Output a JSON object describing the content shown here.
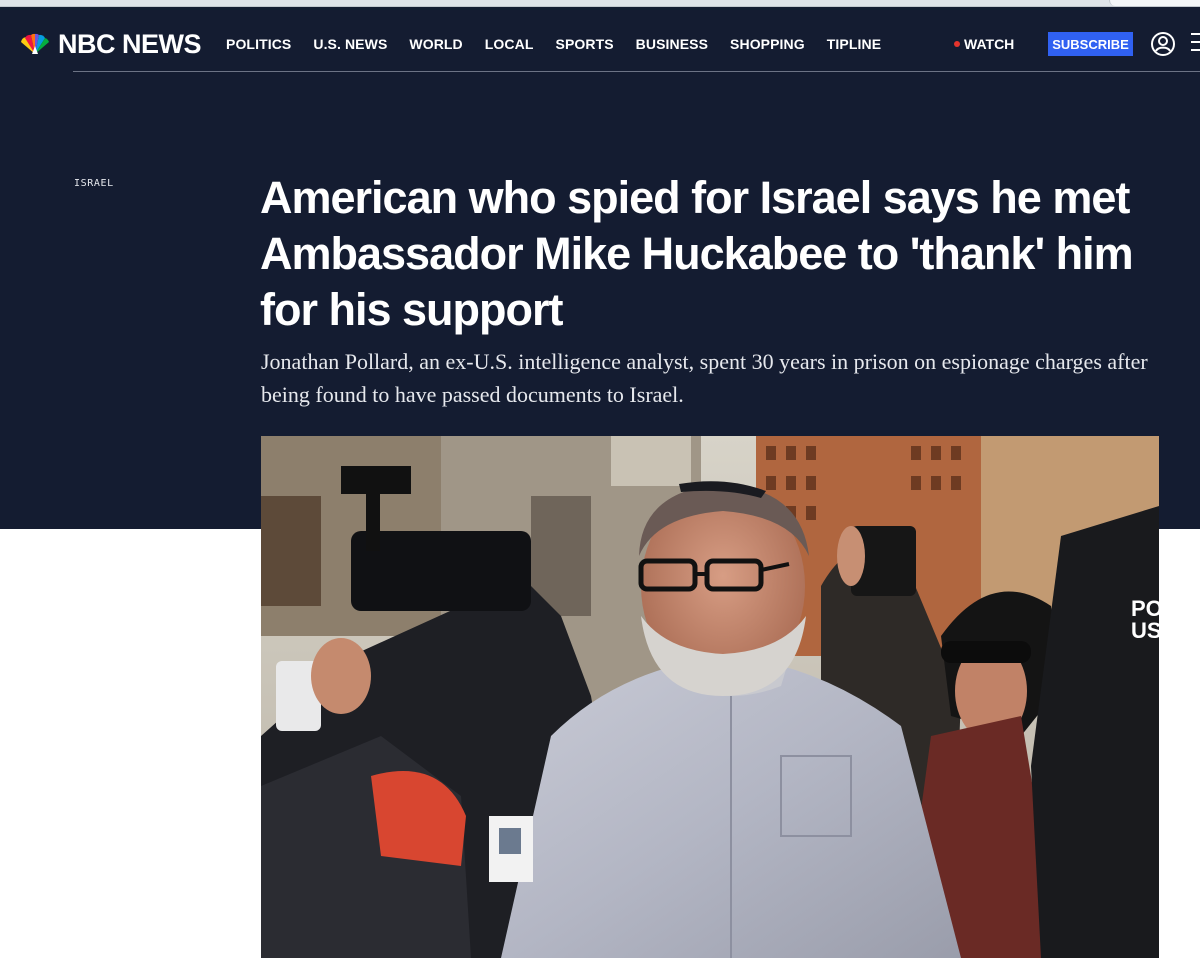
{
  "header": {
    "logo_text": "NBC NEWS",
    "nav_items": [
      "POLITICS",
      "U.S. NEWS",
      "WORLD",
      "LOCAL",
      "SPORTS",
      "BUSINESS",
      "SHOPPING",
      "TIPLINE"
    ],
    "watch_label": "WATCH",
    "subscribe_label": "SUBSCRIBE",
    "icons": [
      "peacock-logo-icon",
      "account-icon",
      "menu-icon"
    ]
  },
  "article": {
    "section": "ISRAEL",
    "headline": "American who spied for Israel says he met Ambassador Mike Huckabee to 'thank' him for his support",
    "dek": "Jonathan Pollard, an ex-U.S. intelligence analyst, spent 30 years in prison on espionage charges after being found to have passed documents to Israel."
  },
  "colors": {
    "hero_background": "#141c31",
    "subscribe_button": "#3061f2",
    "live_dot": "#e5342d",
    "text_on_dark": "#ffffff"
  }
}
